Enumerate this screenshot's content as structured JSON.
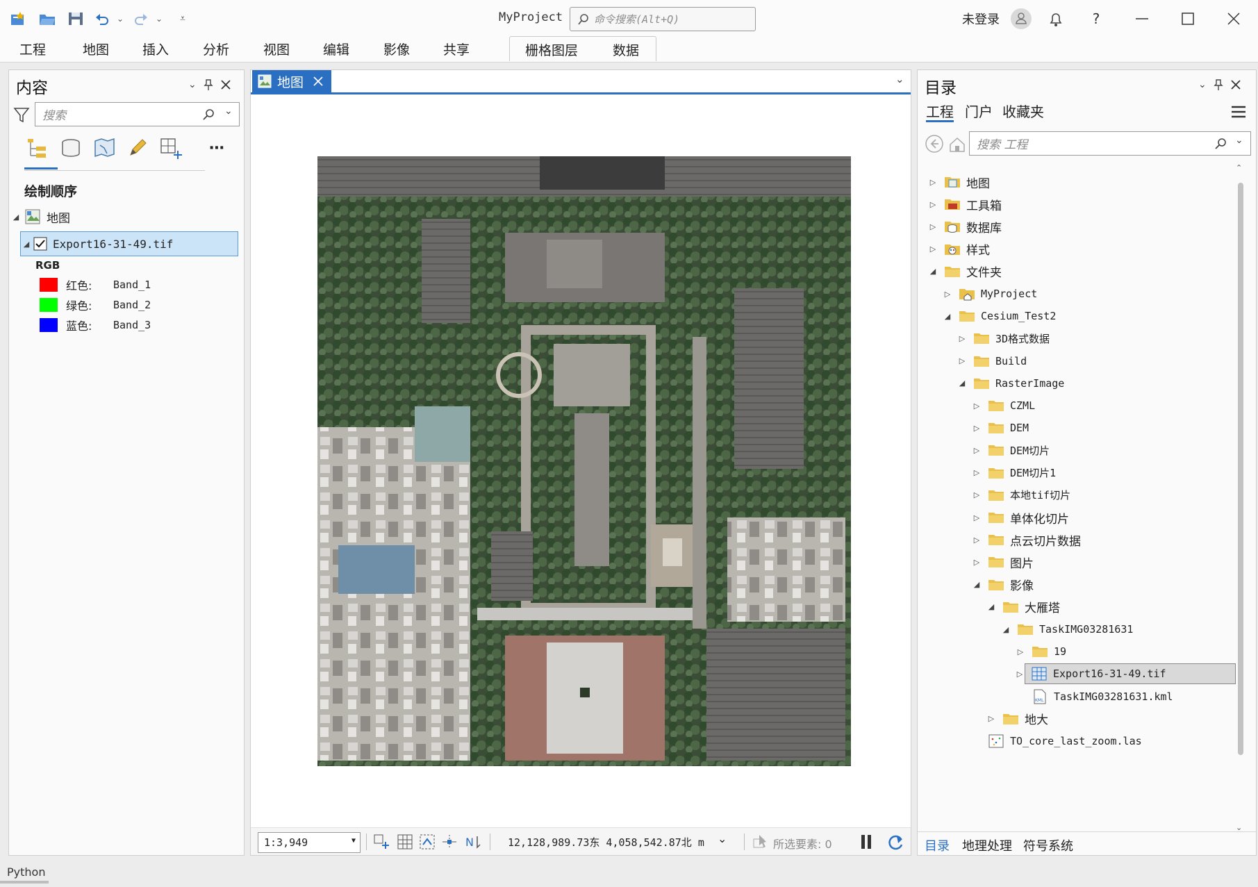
{
  "app": {
    "title": "MyProject",
    "command_search_placeholder": "命令搜索(Alt+Q)",
    "login_text": "未登录"
  },
  "ribbon": {
    "tabs": [
      "工程",
      "地图",
      "插入",
      "分析",
      "视图",
      "编辑",
      "影像",
      "共享"
    ],
    "context_tabs": [
      "栅格图层",
      "数据"
    ]
  },
  "contents": {
    "title": "内容",
    "search_placeholder": "搜索",
    "drawing_order_label": "绘制顺序",
    "map_label": "地图",
    "layer_name": "Export16-31-49.tif",
    "rgb_label": "RGB",
    "bands": [
      {
        "channel": "红色:",
        "band": "Band_1",
        "color": "#ff0000"
      },
      {
        "channel": "绿色:",
        "band": "Band_2",
        "color": "#00ff00"
      },
      {
        "channel": "蓝色:",
        "band": "Band_3",
        "color": "#0000ff"
      }
    ]
  },
  "map": {
    "tab_label": "地图",
    "scale": "1:3,949",
    "coordinates": "12,128,989.73东 4,058,542.87北 m",
    "selected_features": "所选要素: 0"
  },
  "catalog": {
    "title": "目录",
    "tabs": [
      "工程",
      "门户",
      "收藏夹"
    ],
    "search_placeholder": "搜索 工程",
    "items": [
      {
        "label": "地图",
        "level": 0,
        "expand": "collapsed",
        "icon": "maps-folder-icon"
      },
      {
        "label": "工具箱",
        "level": 0,
        "expand": "collapsed",
        "icon": "toolbox-folder-icon"
      },
      {
        "label": "数据库",
        "level": 0,
        "expand": "collapsed",
        "icon": "database-folder-icon"
      },
      {
        "label": "样式",
        "level": 0,
        "expand": "collapsed",
        "icon": "styles-folder-icon"
      },
      {
        "label": "文件夹",
        "level": 0,
        "expand": "expanded",
        "icon": "folder-icon"
      },
      {
        "label": "MyProject",
        "level": 1,
        "expand": "collapsed",
        "icon": "home-folder-icon"
      },
      {
        "label": "Cesium_Test2",
        "level": 1,
        "expand": "expanded",
        "icon": "folder-icon"
      },
      {
        "label": "3D格式数据",
        "level": 2,
        "expand": "collapsed",
        "icon": "folder-icon"
      },
      {
        "label": "Build",
        "level": 2,
        "expand": "collapsed",
        "icon": "folder-icon"
      },
      {
        "label": "RasterImage",
        "level": 2,
        "expand": "expanded",
        "icon": "folder-icon"
      },
      {
        "label": "CZML",
        "level": 3,
        "expand": "collapsed",
        "icon": "folder-icon"
      },
      {
        "label": "DEM",
        "level": 3,
        "expand": "collapsed",
        "icon": "folder-icon"
      },
      {
        "label": "DEM切片",
        "level": 3,
        "expand": "collapsed",
        "icon": "folder-icon"
      },
      {
        "label": "DEM切片1",
        "level": 3,
        "expand": "collapsed",
        "icon": "folder-icon"
      },
      {
        "label": "本地tif切片",
        "level": 3,
        "expand": "collapsed",
        "icon": "folder-icon"
      },
      {
        "label": "单体化切片",
        "level": 3,
        "expand": "collapsed",
        "icon": "folder-icon"
      },
      {
        "label": "点云切片数据",
        "level": 3,
        "expand": "collapsed",
        "icon": "folder-icon"
      },
      {
        "label": "图片",
        "level": 3,
        "expand": "collapsed",
        "icon": "folder-icon"
      },
      {
        "label": "影像",
        "level": 3,
        "expand": "expanded",
        "icon": "folder-icon"
      },
      {
        "label": "大雁塔",
        "level": 4,
        "expand": "expanded",
        "icon": "folder-icon"
      },
      {
        "label": "TaskIMG03281631",
        "level": 5,
        "expand": "expanded",
        "icon": "folder-icon"
      },
      {
        "label": "19",
        "level": 6,
        "expand": "collapsed",
        "icon": "folder-icon"
      },
      {
        "label": "Export16-31-49.tif",
        "level": 6,
        "expand": "collapsed",
        "icon": "raster-icon",
        "selected": true
      },
      {
        "label": "TaskIMG03281631.kml",
        "level": 6,
        "expand": "none",
        "icon": "kml-icon"
      },
      {
        "label": "地大",
        "level": 4,
        "expand": "collapsed",
        "icon": "folder-icon"
      },
      {
        "label": "TO_core_last_zoom.las",
        "level": 3,
        "expand": "none",
        "icon": "las-icon"
      }
    ],
    "bottom_tabs": [
      "目录",
      "地理处理",
      "符号系统"
    ]
  },
  "python_bar": {
    "label": "Python"
  },
  "colors": {
    "accent": "#2b6fc2",
    "folder": "#e8c04a",
    "selection": "#cce4f7"
  }
}
